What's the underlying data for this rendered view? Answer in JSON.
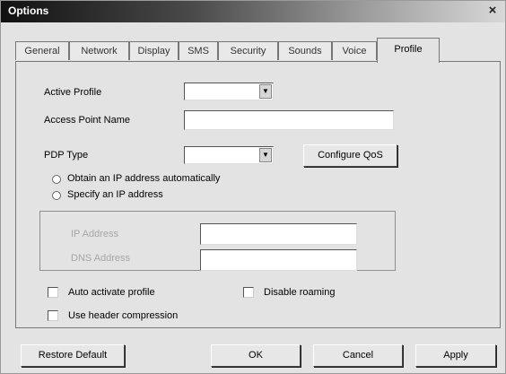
{
  "window": {
    "title": "Options",
    "close_glyph": "×"
  },
  "tabs": [
    {
      "label": "General",
      "active": false
    },
    {
      "label": "Network",
      "active": false
    },
    {
      "label": "Display",
      "active": false
    },
    {
      "label": "SMS",
      "active": false
    },
    {
      "label": "Security",
      "active": false
    },
    {
      "label": "Sounds",
      "active": false
    },
    {
      "label": "Voice",
      "active": false
    },
    {
      "label": "Profile",
      "active": true
    }
  ],
  "profile": {
    "active_profile_label": "Active Profile",
    "active_profile_value": "",
    "apn_label": "Access Point Name",
    "apn_value": "",
    "pdp_type_label": "PDP Type",
    "pdp_type_value": "",
    "configure_qos_label": "Configure QoS",
    "radio_auto_label": "Obtain an IP address automatically",
    "radio_specify_label": "Specify an IP address",
    "ip_address_label": "IP Address",
    "ip_address_value": "",
    "dns_address_label": "DNS Address",
    "dns_address_value": "",
    "auto_activate_label": "Auto activate profile",
    "disable_roaming_label": "Disable roaming",
    "header_compression_label": "Use header compression"
  },
  "footer": {
    "restore_default_label": "Restore Default",
    "ok_label": "OK",
    "cancel_label": "Cancel",
    "apply_label": "Apply"
  }
}
